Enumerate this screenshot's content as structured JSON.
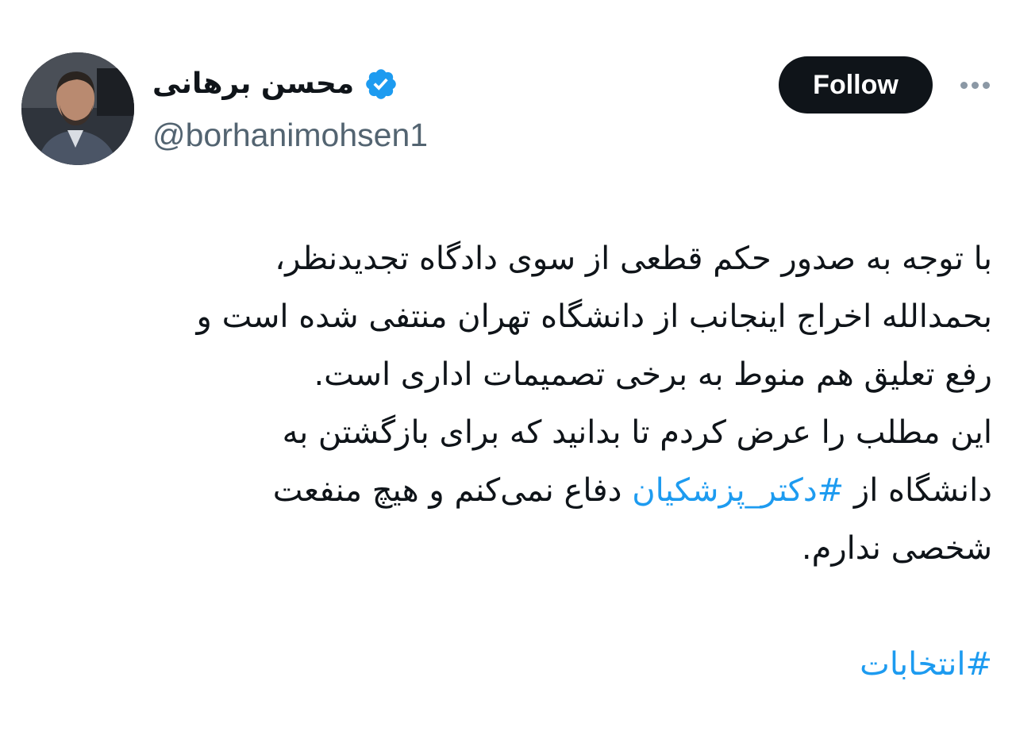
{
  "author": {
    "display_name": "محسن برهانی",
    "handle": "@borhanimohsen1",
    "verified_icon": "verified-badge-icon",
    "verified_color": "#1d9bf0"
  },
  "actions": {
    "follow_label": "Follow",
    "more_icon": "more-options-icon"
  },
  "tweet": {
    "lines": [
      {
        "parts": [
          {
            "text": "با توجه به صدور حکم قطعی از سوی دادگاه تجدیدنظر،",
            "link": false
          }
        ]
      },
      {
        "parts": [
          {
            "text": "بحمدالله اخراج اینجانب از دانشگاه تهران منتفی شده است و",
            "link": false
          }
        ]
      },
      {
        "parts": [
          {
            "text": "رفع تعلیق هم منوط به برخی تصمیمات اداری است.",
            "link": false
          }
        ]
      },
      {
        "parts": [
          {
            "text": "این مطلب را عرض کردم تا بدانید که برای بازگشتن به",
            "link": false
          }
        ]
      },
      {
        "parts": [
          {
            "text": "دانشگاه از ",
            "link": false
          },
          {
            "text": "#دکتر_پزشکیان",
            "link": true
          },
          {
            "text": " دفاع نمی‌کنم و هیچ منفعت",
            "link": false
          }
        ]
      },
      {
        "parts": [
          {
            "text": "شخصی ندارم.",
            "link": false
          }
        ]
      }
    ],
    "closing_hashtag": "#انتخابات"
  },
  "colors": {
    "text": "#0f1419",
    "secondary": "#536471",
    "link": "#1d9bf0",
    "follow_bg": "#0f1419",
    "follow_fg": "#ffffff"
  }
}
